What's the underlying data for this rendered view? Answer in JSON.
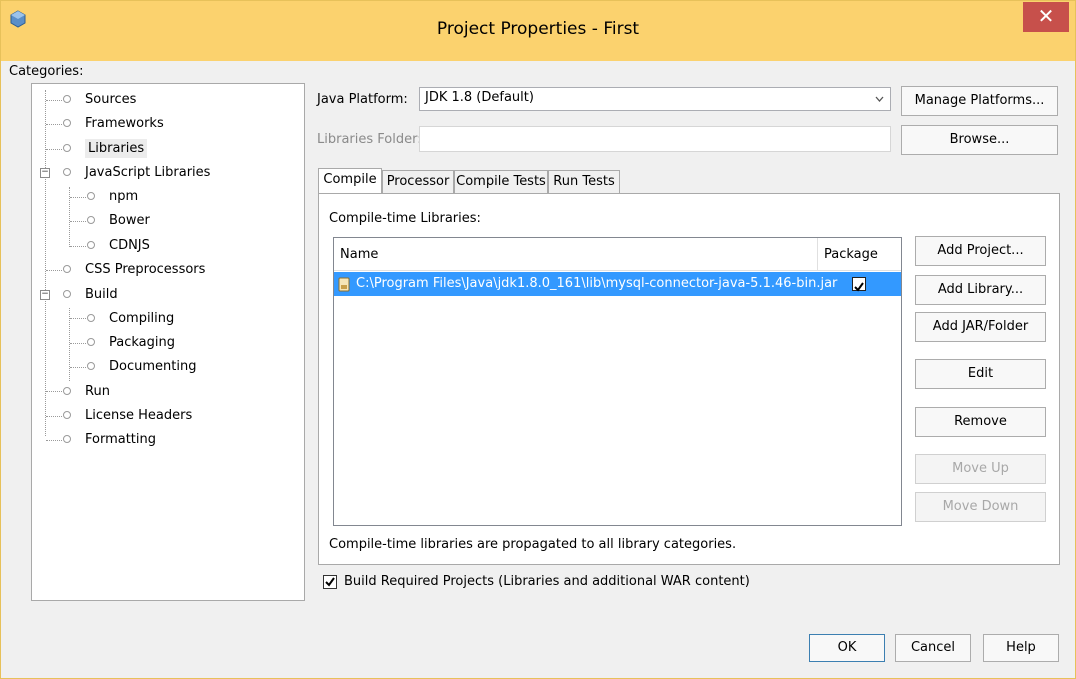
{
  "window": {
    "title": "Project Properties - First",
    "close_glyph": "✕"
  },
  "categories": {
    "label": "Categories:",
    "items": [
      {
        "label": "Sources"
      },
      {
        "label": "Frameworks"
      },
      {
        "label": "Libraries",
        "selected": true
      },
      {
        "label": "JavaScript Libraries",
        "expanded": true
      },
      {
        "label": "npm"
      },
      {
        "label": "Bower"
      },
      {
        "label": "CDNJS"
      },
      {
        "label": "CSS Preprocessors"
      },
      {
        "label": "Build",
        "expanded": true
      },
      {
        "label": "Compiling"
      },
      {
        "label": "Packaging"
      },
      {
        "label": "Documenting"
      },
      {
        "label": "Run"
      },
      {
        "label": "License Headers"
      },
      {
        "label": "Formatting"
      }
    ]
  },
  "java_platform": {
    "label": "Java Platform:",
    "value": "JDK 1.8 (Default)",
    "manage_button": "Manage Platforms..."
  },
  "libraries_folder": {
    "label": "Libraries Folder:",
    "value": "",
    "browse_button": "Browse..."
  },
  "tabs": [
    {
      "label": "Compile",
      "active": true
    },
    {
      "label": "Processor"
    },
    {
      "label": "Compile Tests"
    },
    {
      "label": "Run Tests"
    }
  ],
  "compile": {
    "section_label": "Compile-time Libraries:",
    "columns": [
      "Name",
      "Package"
    ],
    "rows": [
      {
        "name": "C:\\Program Files\\Java\\jdk1.8.0_161\\lib\\mysql-connector-java-5.1.46-bin.jar",
        "package": true
      }
    ],
    "note": "Compile-time libraries are propagated to all library categories."
  },
  "side_buttons": {
    "add_project": "Add Project...",
    "add_library": "Add Library...",
    "add_jar": "Add JAR/Folder",
    "edit": "Edit",
    "remove": "Remove",
    "move_up": "Move Up",
    "move_down": "Move Down"
  },
  "build_required": {
    "label": "Build Required Projects (Libraries and additional WAR content)",
    "checked": true
  },
  "footer": {
    "ok": "OK",
    "cancel": "Cancel",
    "help": "Help"
  },
  "colors": {
    "titlebar": "#fbd26e",
    "close": "#c7504b",
    "selection": "#3399ff"
  }
}
